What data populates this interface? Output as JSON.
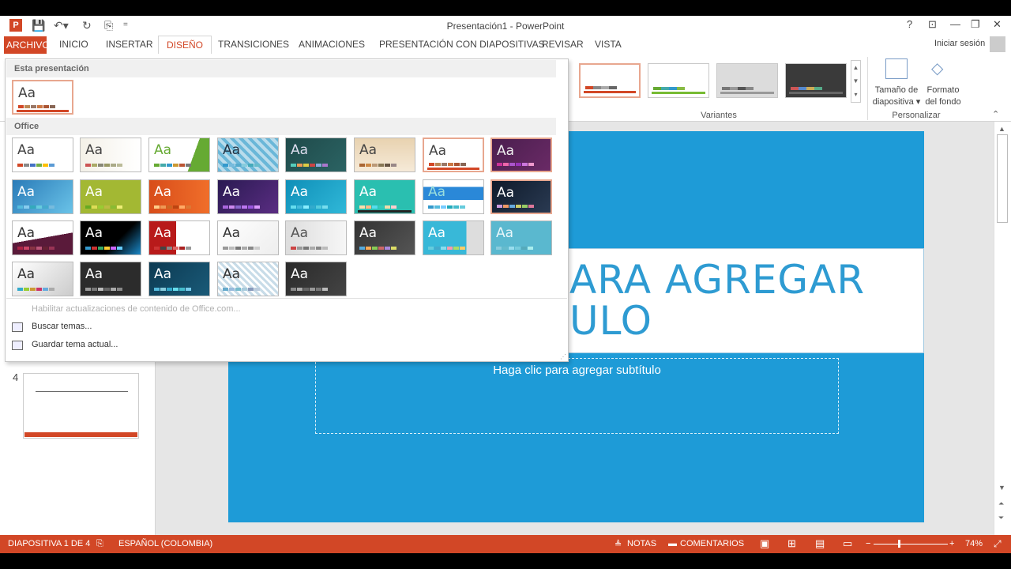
{
  "window": {
    "title": "Presentación1 - PowerPoint",
    "help": "?",
    "signin": "Iniciar sesión"
  },
  "tabs": [
    "ARCHIVO",
    "INICIO",
    "INSERTAR",
    "DISEÑO",
    "TRANSICIONES",
    "ANIMACIONES",
    "PRESENTACIÓN CON DIAPOSITIVAS",
    "REVISAR",
    "VISTA"
  ],
  "ribbon": {
    "variants_label": "Variantes",
    "customize_label": "Personalizar",
    "slide_size": [
      "Tamaño de",
      "diapositiva ▾"
    ],
    "format_bg": [
      "Formato",
      "del fondo"
    ]
  },
  "gallery": {
    "this_presentation": "Esta presentación",
    "office": "Office",
    "thumb_text": "Aa",
    "menu": {
      "enable_updates": "Habilitar actualizaciones de contenido de Office.com...",
      "browse": "Buscar temas...",
      "save": "Guardar tema actual..."
    }
  },
  "slide": {
    "title_line1": "ARA AGREGAR",
    "title_line2": "ULO",
    "subtitle": "Haga clic para agregar subtítulo"
  },
  "panel": {
    "slide4_number": "4"
  },
  "status": {
    "slide_info": "DIAPOSITIVA 1 DE 4",
    "language": "ESPAÑOL (COLOMBIA)",
    "notes": "NOTAS",
    "comments": "COMENTARIOS",
    "zoom": "74%"
  },
  "colors": {
    "accent": "#d24726",
    "slide_bg": "#1e9bd7",
    "title_text": "#2e9bd2"
  }
}
